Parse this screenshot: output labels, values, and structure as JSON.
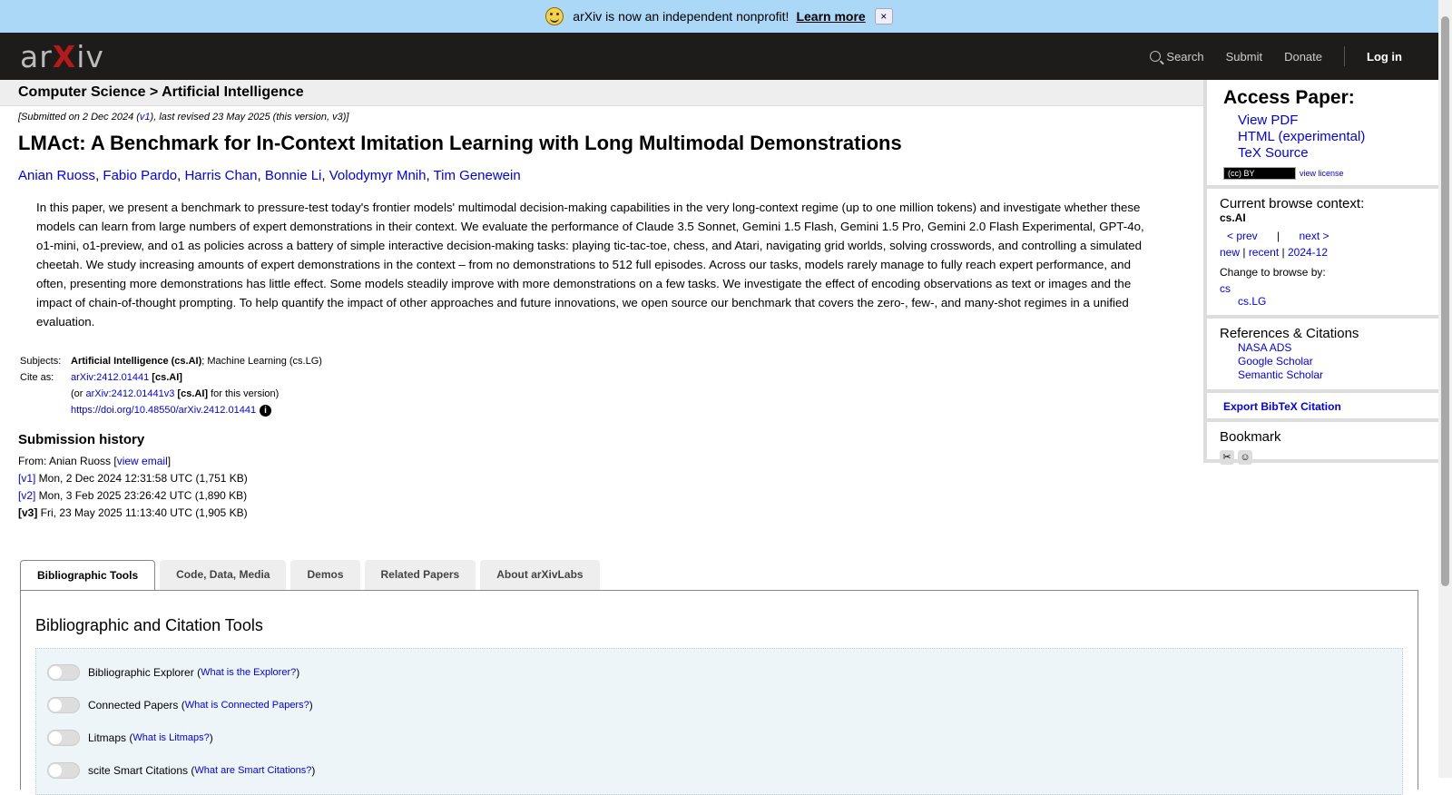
{
  "banner": {
    "text": "arXiv is now an independent nonprofit!",
    "link": "Learn more",
    "close": "×"
  },
  "header": {
    "logo_prefix": "ar",
    "logo_x": "X",
    "logo_suffix": "iv",
    "search": "Search",
    "submit": "Submit",
    "donate": "Donate",
    "login": "Log in"
  },
  "breadcrumb": "Computer Science > Artificial Intelligence",
  "paper": {
    "dateline_pre": "[Submitted on 2 Dec 2024 (",
    "dateline_v1": "v1",
    "dateline_post": "), last revised 23 May 2025 (this version, v3)]",
    "title": "LMAct: A Benchmark for In-Context Imitation Learning with Long Multimodal Demonstrations",
    "authors": [
      "Anian Ruoss",
      "Fabio Pardo",
      "Harris Chan",
      "Bonnie Li",
      "Volodymyr Mnih",
      "Tim Genewein"
    ],
    "abstract": "In this paper, we present a benchmark to pressure-test today's frontier models' multimodal decision-making capabilities in the very long-context regime (up to one million tokens) and investigate whether these models can learn from large numbers of expert demonstrations in their context. We evaluate the performance of Claude 3.5 Sonnet, Gemini 1.5 Flash, Gemini 1.5 Pro, Gemini 2.0 Flash Experimental, GPT-4o, o1-mini, o1-preview, and o1 as policies across a battery of simple interactive decision-making tasks: playing tic-tac-toe, chess, and Atari, navigating grid worlds, solving crosswords, and controlling a simulated cheetah. We study increasing amounts of expert demonstrations in the context – from no demonstrations to 512 full episodes. Across our tasks, models rarely manage to fully reach expert performance, and often, presenting more demonstrations has little effect. Some models steadily improve with more demonstrations on a few tasks. We investigate the effect of encoding observations as text or images and the impact of chain-of-thought prompting. To help quantify the impact of other approaches and future innovations, we open source our benchmark that covers the zero-, few-, and many-shot regimes in a unified evaluation."
  },
  "meta": {
    "subjects_label": "Subjects:",
    "subjects_primary": "Artificial Intelligence (cs.AI)",
    "subjects_rest": "; Machine Learning (cs.LG)",
    "cite_label": "Cite as:",
    "cite_id": "arXiv:2412.01441",
    "cite_cat": "[cs.AI]",
    "or_pre": "(or ",
    "cite_v3": "arXiv:2412.01441v3",
    "cite_v3_cat": "[cs.AI]",
    "or_post": " for this version)",
    "doi": "https://doi.org/10.48550/arXiv.2412.01441",
    "info": "i"
  },
  "history": {
    "title": "Submission history",
    "from_pre": "From: Anian Ruoss [",
    "from_link": "view email",
    "from_post": "]",
    "versions": [
      {
        "tag": "[v1]",
        "text": " Mon, 2 Dec 2024 12:31:58 UTC (1,751 KB)"
      },
      {
        "tag": "[v2]",
        "text": " Mon, 3 Feb 2025 23:26:42 UTC (1,890 KB)"
      },
      {
        "tag": "[v3]",
        "text": " Fri, 23 May 2025 11:13:40 UTC (1,905 KB)"
      }
    ]
  },
  "sidebar": {
    "access_title": "Access Paper:",
    "links": [
      "View PDF",
      "HTML (experimental)",
      "TeX Source"
    ],
    "cc_badge": "(cc) BY",
    "view_license": "view license",
    "browse_title": "Current browse context:",
    "browse_cat": "cs.AI",
    "prev": "< prev",
    "pipe": "|",
    "next": "next >",
    "new": "new",
    "recent": "recent",
    "month": "2024-12",
    "change_browse": "Change to browse by:",
    "cs": "cs",
    "cslg": "cs.LG",
    "refs_title": "References & Citations",
    "refs": [
      "NASA ADS",
      "Google Scholar",
      "Semantic Scholar"
    ],
    "export": "Export BibTeX Citation",
    "bookmark": "Bookmark"
  },
  "tabs": [
    "Bibliographic Tools",
    "Code, Data, Media",
    "Demos",
    "Related Papers",
    "About arXivLabs"
  ],
  "panel": {
    "title": "Bibliographic and Citation Tools",
    "tools": [
      {
        "name": "Bibliographic Explorer",
        "link": "What is the Explorer?"
      },
      {
        "name": "Connected Papers",
        "link": "What is Connected Papers?"
      },
      {
        "name": "Litmaps",
        "link": "What is Litmaps?"
      },
      {
        "name": "scite Smart Citations",
        "link": "What are Smart Citations?"
      }
    ]
  }
}
